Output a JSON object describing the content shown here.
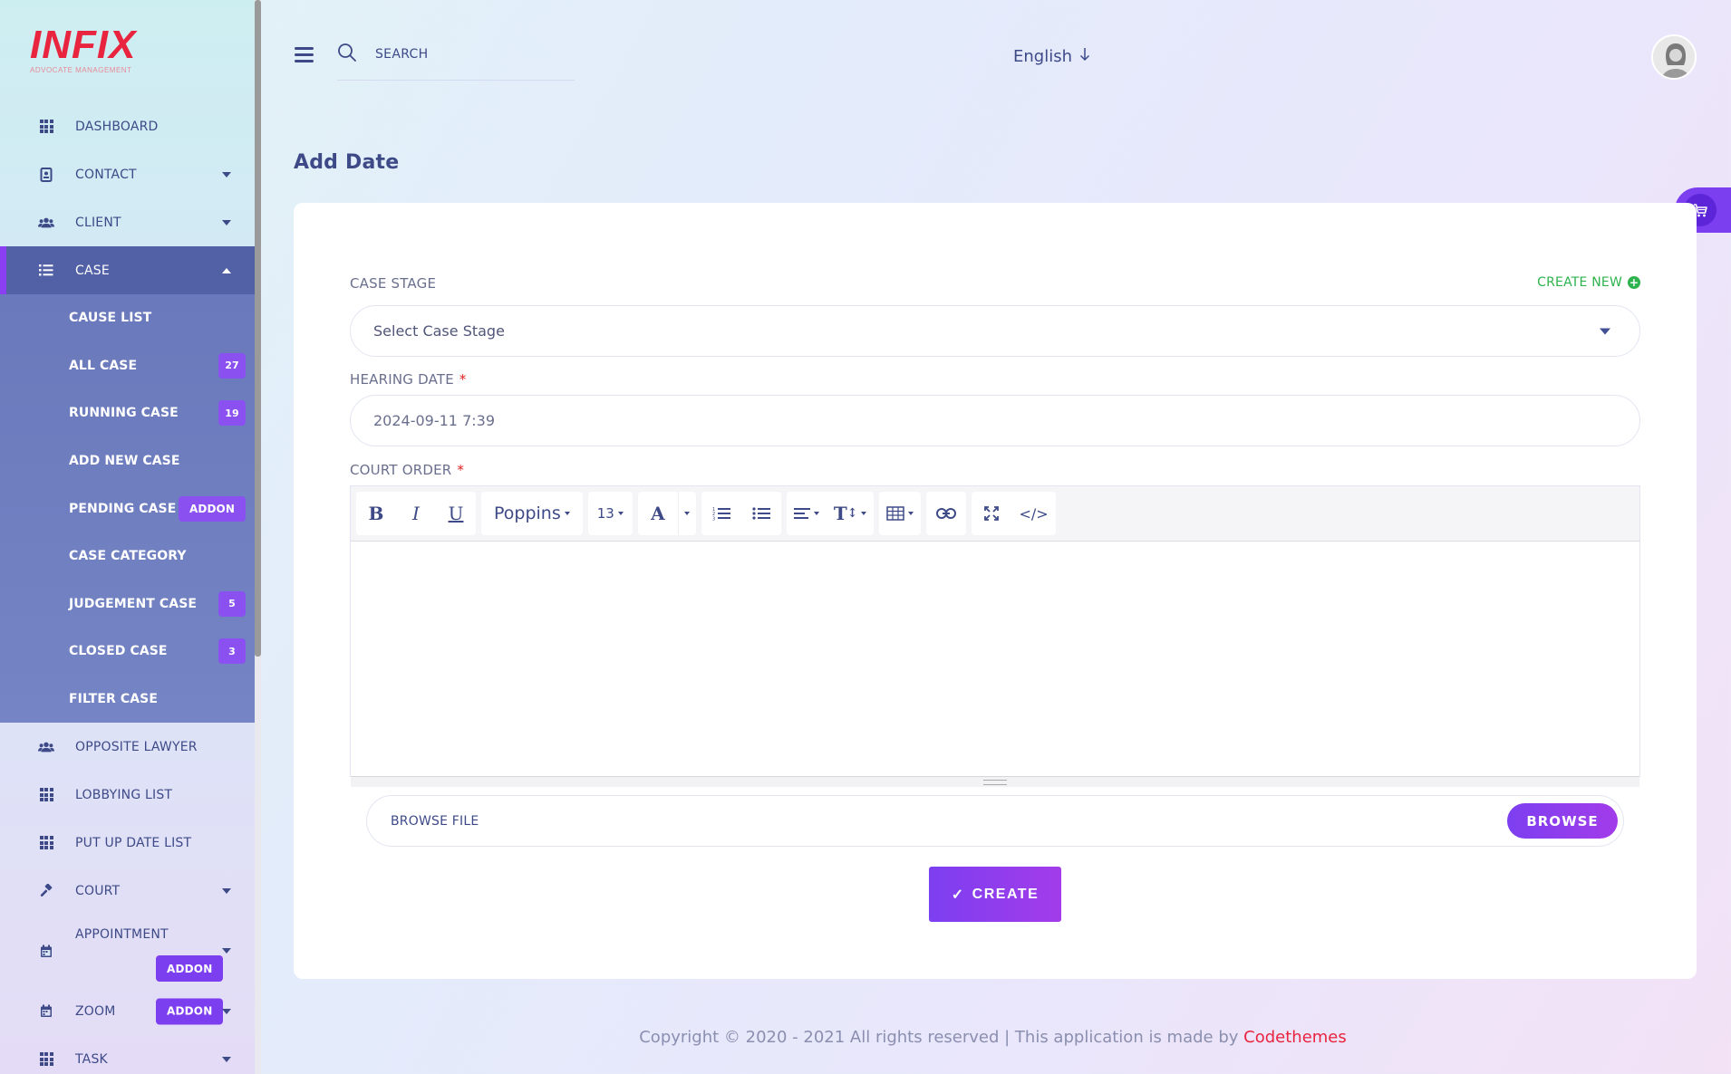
{
  "brand": {
    "logo": "INFIX",
    "subtitle": "ADVOCATE MANAGEMENT"
  },
  "topbar": {
    "search_label": "SEARCH",
    "language": "English"
  },
  "sidebar": {
    "items": [
      {
        "label": "DASHBOARD",
        "icon": "grid-icon"
      },
      {
        "label": "CONTACT",
        "icon": "contact-book-icon"
      },
      {
        "label": "CLIENT",
        "icon": "users-icon"
      },
      {
        "label": "CASE",
        "icon": "list-icon"
      }
    ],
    "case_sub": [
      {
        "label": "CAUSE LIST"
      },
      {
        "label": "ALL CASE",
        "badge": "27"
      },
      {
        "label": "RUNNING CASE",
        "badge": "19"
      },
      {
        "label": "ADD NEW CASE"
      },
      {
        "label": "PENDING CASE",
        "badge": "ADDON"
      },
      {
        "label": "CASE CATEGORY"
      },
      {
        "label": "JUDGEMENT CASE",
        "badge": "5"
      },
      {
        "label": "CLOSED CASE",
        "badge": "3"
      },
      {
        "label": "FILTER CASE"
      }
    ],
    "items_after": [
      {
        "label": "OPPOSITE LAWYER",
        "icon": "users-icon"
      },
      {
        "label": "LOBBYING LIST",
        "icon": "grid-icon"
      },
      {
        "label": "PUT UP DATE LIST",
        "icon": "grid-icon"
      },
      {
        "label": "COURT",
        "icon": "gavel-icon"
      },
      {
        "label": "APPOINTMENT",
        "icon": "calendar-icon",
        "badge": "ADDON"
      },
      {
        "label": "ZOOM",
        "icon": "calendar-icon",
        "badge": "ADDON"
      },
      {
        "label": "TASK",
        "icon": "grid-icon"
      }
    ]
  },
  "page": {
    "title": "Add Date"
  },
  "form": {
    "case_stage_label": "CASE STAGE",
    "create_new": "CREATE NEW",
    "case_stage_placeholder": "Select Case Stage",
    "hearing_date_label": "HEARING DATE",
    "hearing_date_value": "2024-09-11 7:39",
    "court_order_label": "COURT ORDER",
    "required_mark": "*",
    "editor": {
      "font_family": "Poppins",
      "font_size": "13"
    },
    "browse_file_label": "BROWSE FILE",
    "browse_button": "BROWSE",
    "create_button": "CREATE"
  },
  "footer": {
    "text": "Copyright © 2020 - 2021 All rights reserved | This application is made by ",
    "brand": "Codethemes"
  },
  "colors": {
    "accent": "#7c3ff0",
    "nav_text": "#3d4a87",
    "active_bg": "#5260a5",
    "brand_red": "#e8243f",
    "green": "#2db24d"
  }
}
